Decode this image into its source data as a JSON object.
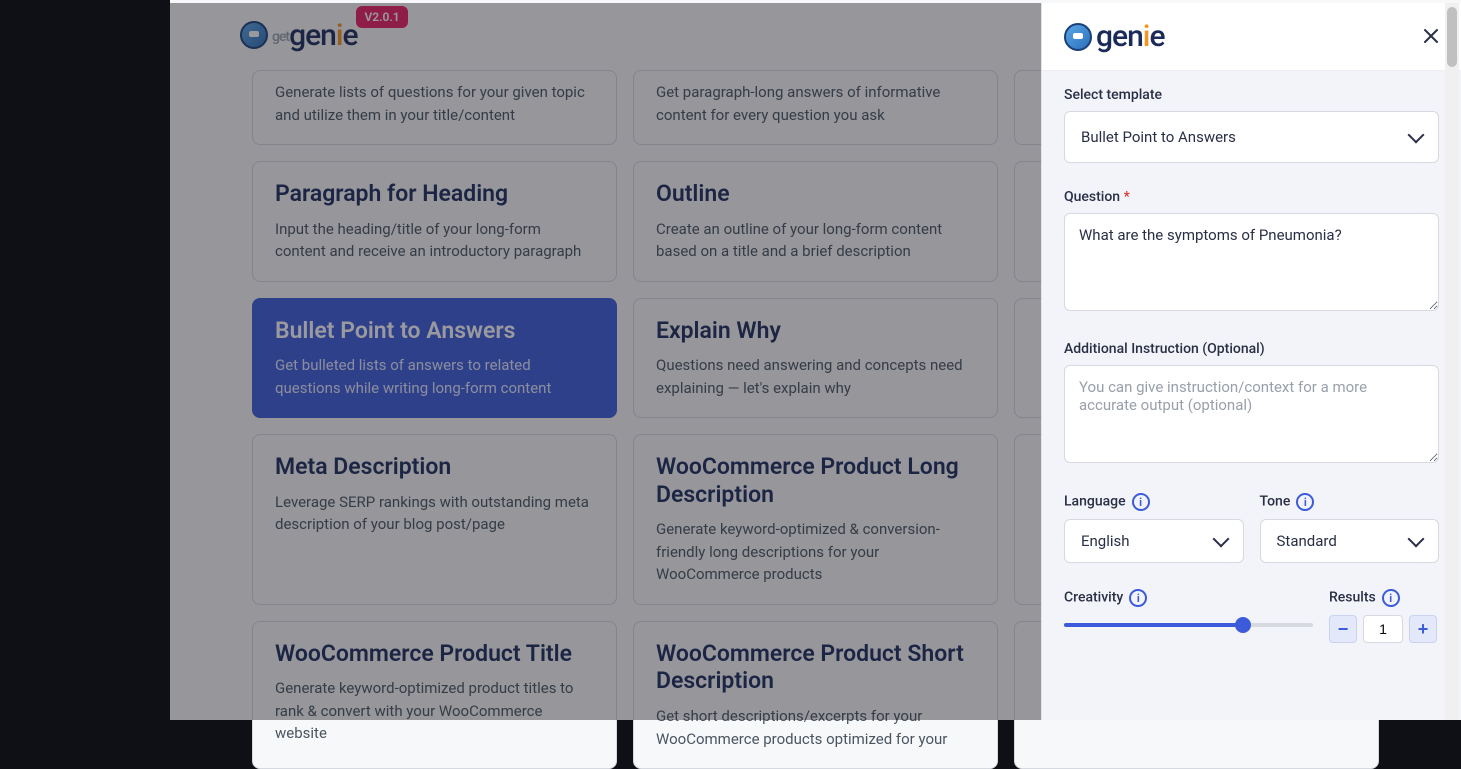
{
  "brand": {
    "get": "get",
    "name": "genie",
    "version": "V2.0.1"
  },
  "cards": [
    {
      "title": "",
      "desc": "Generate lists of questions for your given topic and utilize them in your title/content",
      "selected": false,
      "partial": true
    },
    {
      "title": "",
      "desc": "Get paragraph-long answers of informative content for every question you ask",
      "selected": false,
      "partial": true
    },
    {
      "title": "",
      "desc": "",
      "selected": false,
      "partial": true
    },
    {
      "title": "Paragraph for Heading",
      "desc": "Input the heading/title of your long-form content and receive an introductory paragraph",
      "selected": false
    },
    {
      "title": "Outline",
      "desc": "Create an outline of your long-form content based on a title and a brief description",
      "selected": false
    },
    {
      "title": "",
      "desc": "",
      "selected": false
    },
    {
      "title": "Bullet Point to Answers",
      "desc": "Get bulleted lists of answers to related questions while writing long-form content",
      "selected": true
    },
    {
      "title": "Explain Why",
      "desc": "Questions need answering and concepts need explaining — let's explain why",
      "selected": false
    },
    {
      "title": "",
      "desc": "",
      "selected": false
    },
    {
      "title": "Meta Description",
      "desc": "Leverage SERP rankings with outstanding meta description of your blog post/page",
      "selected": false
    },
    {
      "title": "WooCommerce Product Long Description",
      "desc": "Generate keyword-optimized & conversion-friendly long descriptions for your WooCommerce products",
      "selected": false
    },
    {
      "title": "",
      "desc": "",
      "selected": false
    },
    {
      "title": "WooCommerce Product Title",
      "desc": "Generate keyword-optimized product titles to rank & convert with your WooCommerce website",
      "selected": false
    },
    {
      "title": "WooCommerce Product Short Description",
      "desc": "Get short descriptions/excerpts for your WooCommerce products optimized for your",
      "selected": false
    },
    {
      "title": "",
      "desc": "",
      "selected": false
    }
  ],
  "panel": {
    "template_label": "Select template",
    "template_value": "Bullet Point to Answers",
    "question_label": "Question",
    "question_value": "What are the symptoms of Pneumonia?",
    "additional_label": "Additional Instruction (Optional)",
    "additional_placeholder": "You can give instruction/context for a more accurate output (optional)",
    "language_label": "Language",
    "language_value": "English",
    "tone_label": "Tone",
    "tone_value": "Standard",
    "creativity_label": "Creativity",
    "creativity_percent": 72,
    "results_label": "Results",
    "results_value": "1"
  }
}
